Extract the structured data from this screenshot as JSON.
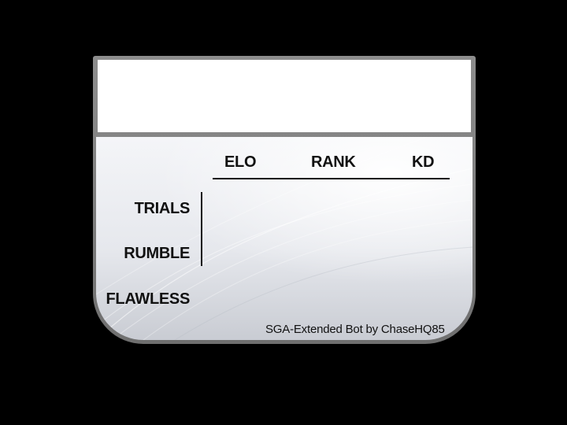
{
  "table": {
    "columns": [
      "ELO",
      "RANK",
      "KD"
    ],
    "rows": [
      "TRIALS",
      "RUMBLE",
      "FLAWLESS"
    ]
  },
  "footer": {
    "credit": "SGA-Extended Bot by ChaseHQ85"
  },
  "colors": {
    "background": "#000000",
    "frame": "#7a7a7a",
    "header_box": "#ffffff",
    "panel": "#e6e8ed",
    "text": "#111111"
  }
}
